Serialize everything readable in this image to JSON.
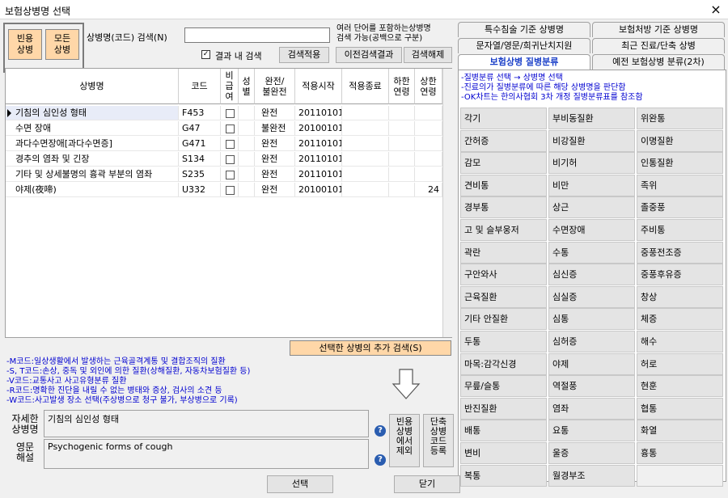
{
  "window": {
    "title": "보험상병명 선택",
    "close": "×"
  },
  "toolbar": {
    "common_btn": "빈용\n상병",
    "all_btn": "모든\n상병",
    "search_label": "상병명(코드) 검색(N)",
    "search_value": "",
    "hint": "여러 단어를 포함하는상병명\n검색 가능(공백으로 구분)",
    "in_result_label": "결과 내 검색",
    "apply_btn": "검색적용",
    "prev_btn": "이전검색결과",
    "clear_btn": "검색해제"
  },
  "grid": {
    "headers": [
      "상병명",
      "코드",
      "비\n급\n여",
      "성\n별",
      "완전/\n불완전",
      "적용시작",
      "적용종료",
      "하한\n연령",
      "상한\n연령"
    ],
    "rows": [
      {
        "name": "기침의 심인성 형태",
        "code": "F453",
        "complete": "완전",
        "start": "20110101",
        "end": "",
        "lo": "",
        "hi": ""
      },
      {
        "name": "수면 장애",
        "code": "G47",
        "complete": "불완전",
        "start": "20100101",
        "end": "",
        "lo": "",
        "hi": ""
      },
      {
        "name": "과다수면장애[과다수면증]",
        "code": "G471",
        "complete": "완전",
        "start": "20110101",
        "end": "",
        "lo": "",
        "hi": ""
      },
      {
        "name": "경추의 염좌 및 긴장",
        "code": "S134",
        "complete": "완전",
        "start": "20110101",
        "end": "",
        "lo": "",
        "hi": ""
      },
      {
        "name": "기타 및 상세불명의 흉곽 부분의 염좌",
        "code": "S235",
        "complete": "완전",
        "start": "20110101",
        "end": "",
        "lo": "",
        "hi": ""
      },
      {
        "name": "야제(夜啼)",
        "code": "U332",
        "complete": "완전",
        "start": "20100101",
        "end": "",
        "lo": "",
        "hi": "24"
      }
    ]
  },
  "add_search_btn": "선택한 상병의 추가 검색(S)",
  "notes": [
    "-M코드:일상생활에서 발생하는 근육골격계통 및 결합조직의 질환",
    "-S, T코드:손상, 중독 및 외인에 의한 질환(상해질환, 자동차보험질환 등)",
    "-V코드:교통사고 사고유형분류 질환",
    "-R코드:명확한 진단을 내릴 수 없는 병태와 증상, 검사의 소견 등",
    "-W코드:사고발생 장소 선택(주상병으로 청구 불가, 부상병으로 기록)"
  ],
  "detail": {
    "name_label": "자세한\n상병명",
    "name_value": "기침의 심인성 형태",
    "eng_label": "영문\n해설",
    "eng_value": "Psychogenic forms of cough",
    "help": "?",
    "exclude_btn": "빈용\n상병\n에서\n제외",
    "shortcut_btn": "단축\n상병\n코드\n등록"
  },
  "tabs": {
    "row1": [
      "특수침술 기준 상병명",
      "보험처방 기준 상병명"
    ],
    "row2": [
      "문자열/영문/희귀난치지원",
      "최근 진료/단축 상병"
    ],
    "row3": [
      "보험상병 질병분류",
      "예전 보험상병 분류(2차)"
    ]
  },
  "panel_notes": [
    "-질병분류 선택 → 상병명 선택",
    "-진료의가 질병분류에 따른 해당 상병명을 판단함",
    "-OK차트는 한의사협회 3차 개정 질병분류표를 참조함"
  ],
  "categories": [
    [
      "각기",
      "부비동질환",
      "위완통"
    ],
    [
      "간허증",
      "비강질환",
      "이명질환"
    ],
    [
      "감모",
      "비기허",
      "인통질환"
    ],
    [
      "견비통",
      "비만",
      "족위"
    ],
    [
      "경부통",
      "상근",
      "졸중풍"
    ],
    [
      "고 및 슬부웅저",
      "수면장애",
      "주비통"
    ],
    [
      "곽란",
      "수통",
      "중풍전조증"
    ],
    [
      "구안와사",
      "심신증",
      "중풍후유증"
    ],
    [
      "근육질환",
      "심실증",
      "창상"
    ],
    [
      "기타 안질환",
      "심통",
      "체증"
    ],
    [
      "두통",
      "심허증",
      "해수"
    ],
    [
      "마목:감각신경",
      "야제",
      "허로"
    ],
    [
      "무릎/슬통",
      "역절풍",
      "현훈"
    ],
    [
      "반진질환",
      "염좌",
      "협통"
    ],
    [
      "배통",
      "요통",
      "화열"
    ],
    [
      "변비",
      "울증",
      "흉통"
    ],
    [
      "복통",
      "월경부조",
      ""
    ]
  ],
  "footer": {
    "select_btn": "선택",
    "close_btn": "닫기"
  }
}
